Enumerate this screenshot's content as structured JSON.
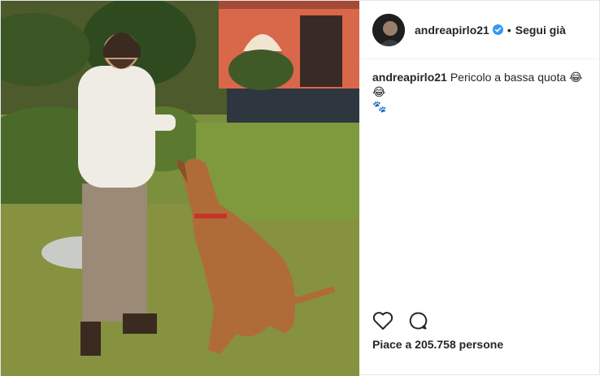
{
  "post": {
    "username": "andreapirlo21",
    "follow_status": "Segui già",
    "separator": "•",
    "caption_text": "Pericolo a bassa quota 😂😂",
    "caption_emoji_line2": "🐾",
    "likes_text": "Piace a 205.758 persone"
  },
  "icons": {
    "verified": "verified-badge-icon",
    "like": "heart-icon",
    "comment": "comment-bubble-icon"
  },
  "colors": {
    "verified_blue": "#3897f0",
    "text": "#262626",
    "border": "#efefef"
  }
}
